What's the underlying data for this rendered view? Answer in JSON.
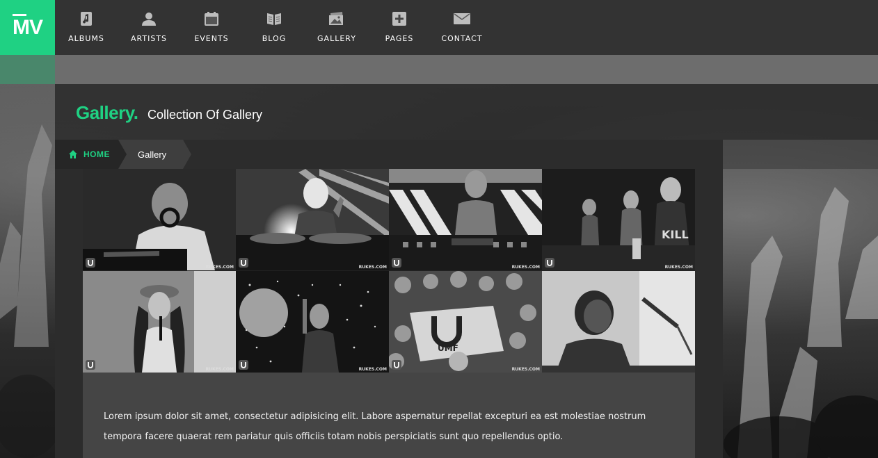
{
  "brand": {
    "logo_text": "MV",
    "accent_color": "#1fd183"
  },
  "nav": {
    "items": [
      {
        "label": "ALBUMS",
        "icon": "music-note-icon"
      },
      {
        "label": "ARTISTS",
        "icon": "user-icon"
      },
      {
        "label": "EVENTS",
        "icon": "calendar-icon"
      },
      {
        "label": "BLOG",
        "icon": "book-icon"
      },
      {
        "label": "GALLERY",
        "icon": "gallery-icon"
      },
      {
        "label": "PAGES",
        "icon": "plus-square-icon"
      },
      {
        "label": "CONTACT",
        "icon": "envelope-icon"
      }
    ]
  },
  "header": {
    "title": "Gallery.",
    "subtitle": "Collection Of Gallery"
  },
  "breadcrumb": {
    "home": "HOME",
    "current": "Gallery"
  },
  "gallery": {
    "watermark": "RUKES.COM",
    "photos": [
      {
        "alt": "DJ with headphones"
      },
      {
        "alt": "Masked DJ"
      },
      {
        "alt": "DJ at decks"
      },
      {
        "alt": "DJs on stage"
      },
      {
        "alt": "Performer with microphone"
      },
      {
        "alt": "DJ with bottle in confetti"
      },
      {
        "alt": "Crowd with UMF flag"
      },
      {
        "alt": "Singer at microphone"
      }
    ]
  },
  "description": "Lorem ipsum dolor sit amet, consectetur adipisicing elit. Labore aspernatur repellat excepturi ea est molestiae nostrum tempora facere quaerat rem pariatur quis officiis totam nobis perspiciatis sunt quo repellendus optio."
}
